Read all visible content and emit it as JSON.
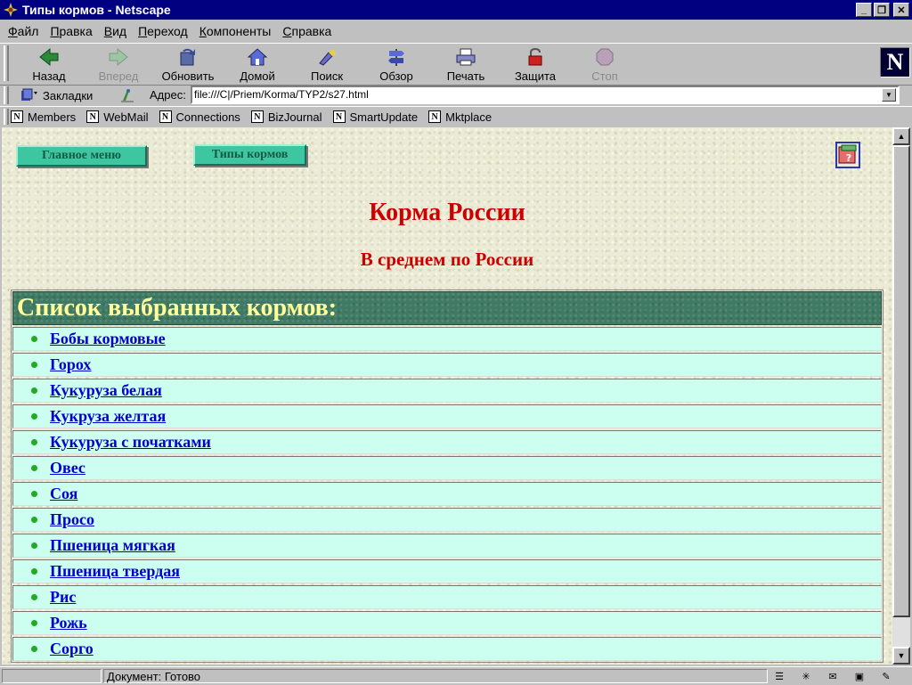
{
  "window": {
    "title": "Типы кормов - Netscape"
  },
  "menu": [
    "Файл",
    "Правка",
    "Вид",
    "Переход",
    "Компоненты",
    "Справка"
  ],
  "toolbar": {
    "back": "Назад",
    "forward": "Вперед",
    "reload": "Обновить",
    "home": "Домой",
    "search": "Поиск",
    "guide": "Обзор",
    "print": "Печать",
    "security": "Защита",
    "stop": "Стоп"
  },
  "location": {
    "bookmarks_label": "Закладки",
    "address_label": "Адрес:",
    "url": "file:///C|/Priem/Korma/TYP2/s27.html"
  },
  "personal": [
    "Members",
    "WebMail",
    "Connections",
    "BizJournal",
    "SmartUpdate",
    "Mktplace"
  ],
  "page": {
    "nav_main": "Главное меню",
    "nav_types": "Типы кормов",
    "heading": "Корма России",
    "subheading": "В среднем по России",
    "list_title": "Список выбранных кормов:",
    "items": [
      "Бобы кормовые",
      "Горох",
      "Кукуруза белая",
      "Кукруза желтая",
      "Кукуруза с початками",
      "Овес",
      "Соя",
      "Просо",
      "Пшеница мягкая",
      "Пшеница твердая",
      "Рис",
      "Рожь",
      "Сорго"
    ]
  },
  "status": {
    "text": "Документ: Готово"
  },
  "colors": {
    "title_bar": "#000080",
    "heading": "#cc0000",
    "link": "#0000cc",
    "row_bg": "#ccfff0",
    "header_bg": "#3f7a63",
    "header_text": "#ffff99",
    "button_bg": "#3ec6a0"
  }
}
